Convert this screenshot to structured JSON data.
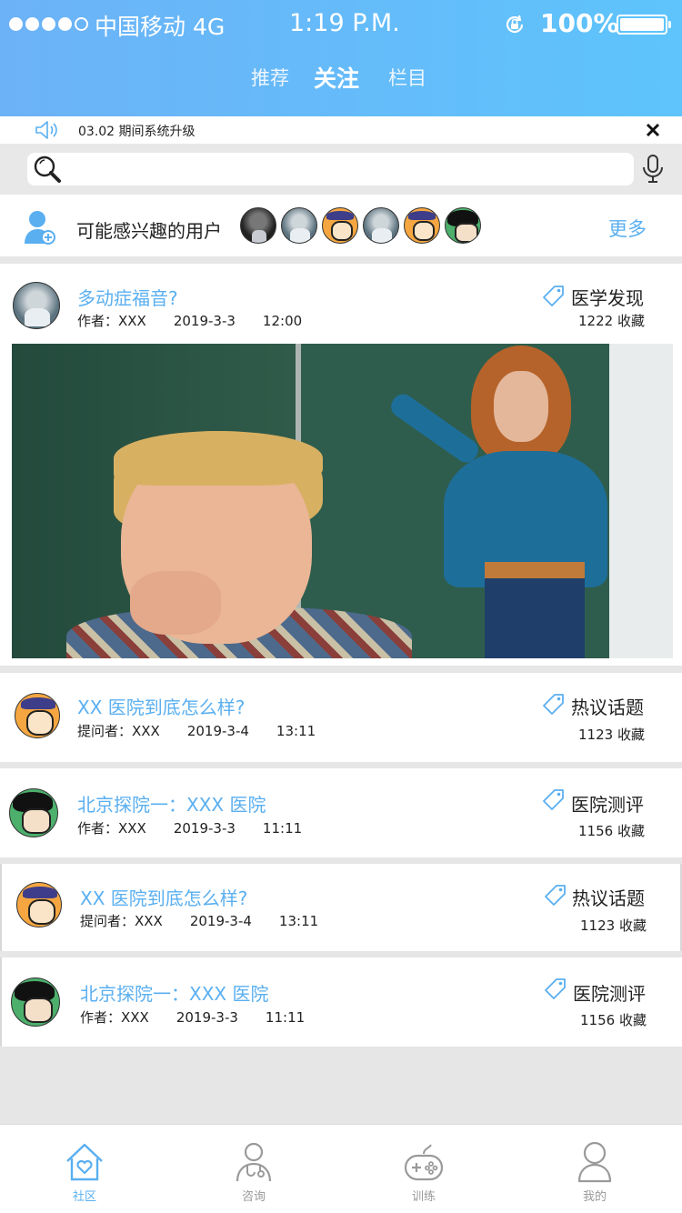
{
  "status_bar": {
    "carrier": "中国移动",
    "network": "4G",
    "time": "1:19 P.M.",
    "battery": "100%",
    "signal_bars_filled": 4,
    "signal_bars_total": 5
  },
  "tabs": [
    {
      "label": "推荐",
      "active": false
    },
    {
      "label": "关注",
      "active": true
    },
    {
      "label": "栏目",
      "active": false
    }
  ],
  "notice": {
    "text": "03.02 期间系统升级"
  },
  "search": {
    "placeholder": "",
    "value": ""
  },
  "suggested_users": {
    "title": "可能感兴趣的用户",
    "more_label": "更多"
  },
  "posts": [
    {
      "title": "多动症福音?",
      "role": "作者：XXX",
      "date": "2019-3-3",
      "time": "12:00",
      "tag": "医学发现",
      "collect": "1222 收藏"
    },
    {
      "title": "XX 医院到底怎么样?",
      "role": "提问者：XXX",
      "date": "2019-3-4",
      "time": "13:11",
      "tag": "热议话题",
      "collect": "1123 收藏"
    },
    {
      "title": "北京探院一：XXX 医院",
      "role": "作者：XXX",
      "date": "2019-3-3",
      "time": "11:11",
      "tag": "医院测评",
      "collect": "1156 收藏"
    },
    {
      "title": "XX 医院到底怎么样?",
      "role": "提问者：XXX",
      "date": "2019-3-4",
      "time": "13:11",
      "tag": "热议话题",
      "collect": "1123 收藏"
    },
    {
      "title": "北京探院一：XXX 医院",
      "role": "作者：XXX",
      "date": "2019-3-3",
      "time": "11:11",
      "tag": "医院测评",
      "collect": "1156 收藏"
    }
  ],
  "tabbar": [
    {
      "label": "社区",
      "icon": "home-heart-icon",
      "active": true
    },
    {
      "label": "咨询",
      "icon": "doctor-icon",
      "active": false
    },
    {
      "label": "训练",
      "icon": "gamepad-icon",
      "active": false
    },
    {
      "label": "我的",
      "icon": "profile-icon",
      "active": false
    }
  ],
  "colors": {
    "accent": "#5aaff0",
    "header_start": "#6cb2f7",
    "header_end": "#5ec4fb"
  }
}
